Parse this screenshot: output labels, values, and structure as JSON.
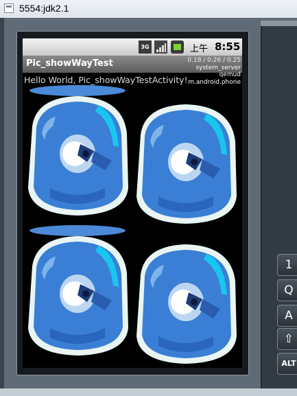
{
  "window": {
    "title": "5554:jdk2.1"
  },
  "status_bar": {
    "network_label": "3G",
    "time_ampm": "上午",
    "time": "8:55"
  },
  "app": {
    "title": "Pic_showWayTest",
    "hello_text": "Hello World, Pic_showWayTestActivity!"
  },
  "load_overlay": {
    "load": "0.18 / 0.26 / 0.25",
    "processes": [
      "system_server",
      "qemud",
      "m.android.phone"
    ]
  },
  "keyboard": {
    "keys": [
      "1",
      "Q",
      "A",
      "⇧",
      "ALT"
    ]
  },
  "colors": {
    "status_bar": "#d8d8d8",
    "title_bar": "#6e6e6e",
    "screen_bg": "#000000",
    "icon_blue": "#3a7fd5",
    "icon_cyan": "#19c6f0"
  },
  "icons": [
    "window-app-icon",
    "3g-icon",
    "signal-icon",
    "battery-icon",
    "shift-icon"
  ]
}
